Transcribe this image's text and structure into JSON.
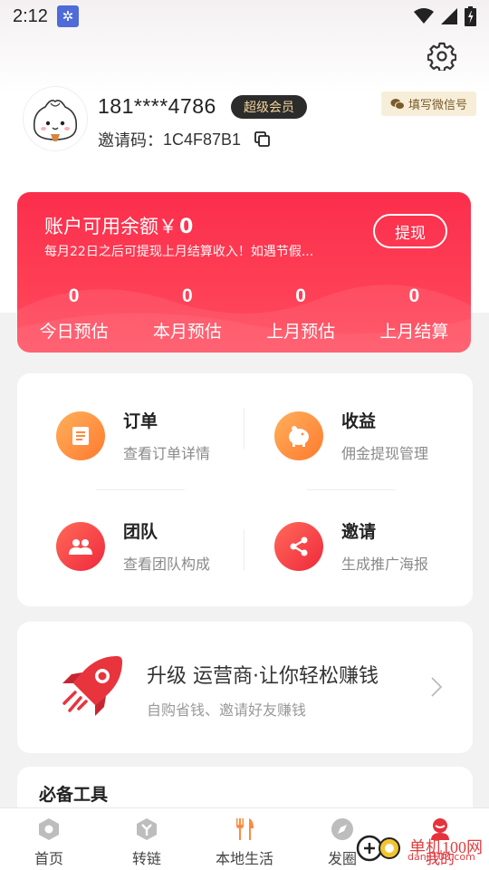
{
  "status_bar": {
    "time": "2:12"
  },
  "wechat_tag": "填写微信号",
  "profile": {
    "phone": "181****4786",
    "vip_label": "超级会员",
    "invite_label": "邀请码：",
    "invite_code": "1C4F87B1"
  },
  "balance": {
    "title": "账户可用余额￥",
    "amount": "0",
    "note": "每月22日之后可提现上月结算收入！如遇节假...",
    "withdraw_label": "提现",
    "stats": [
      {
        "value": "0",
        "label": "今日预估"
      },
      {
        "value": "0",
        "label": "本月预估"
      },
      {
        "value": "0",
        "label": "上月预估"
      },
      {
        "value": "0",
        "label": "上月结算"
      }
    ]
  },
  "menu": [
    {
      "title": "订单",
      "subtitle": "查看订单详情",
      "icon": "document-icon",
      "color": "#ff8a3d"
    },
    {
      "title": "收益",
      "subtitle": "佣金提现管理",
      "icon": "piggy-bank-icon",
      "color": "#ff8a3d"
    },
    {
      "title": "团队",
      "subtitle": "查看团队构成",
      "icon": "team-icon",
      "color": "#f63a44"
    },
    {
      "title": "邀请",
      "subtitle": "生成推广海报",
      "icon": "share-icon",
      "color": "#f63a44"
    }
  ],
  "upgrade": {
    "title": "升级 运营商·让你轻松赚钱",
    "subtitle": "自购省钱、邀请好友赚钱"
  },
  "tools": {
    "title": "必备工具"
  },
  "tabs": [
    {
      "label": "首页",
      "icon": "home-hex-icon"
    },
    {
      "label": "转链",
      "icon": "convert-link-icon"
    },
    {
      "label": "本地生活",
      "icon": "fork-knife-icon"
    },
    {
      "label": "发圈",
      "icon": "compass-icon"
    },
    {
      "label": "我的",
      "icon": "profile-icon"
    }
  ],
  "watermark": {
    "text": "单机100网",
    "sub": "danji100.com"
  },
  "colors": {
    "accent": "#fe3a52",
    "orange": "#ff8a3d",
    "red": "#f63a44"
  }
}
